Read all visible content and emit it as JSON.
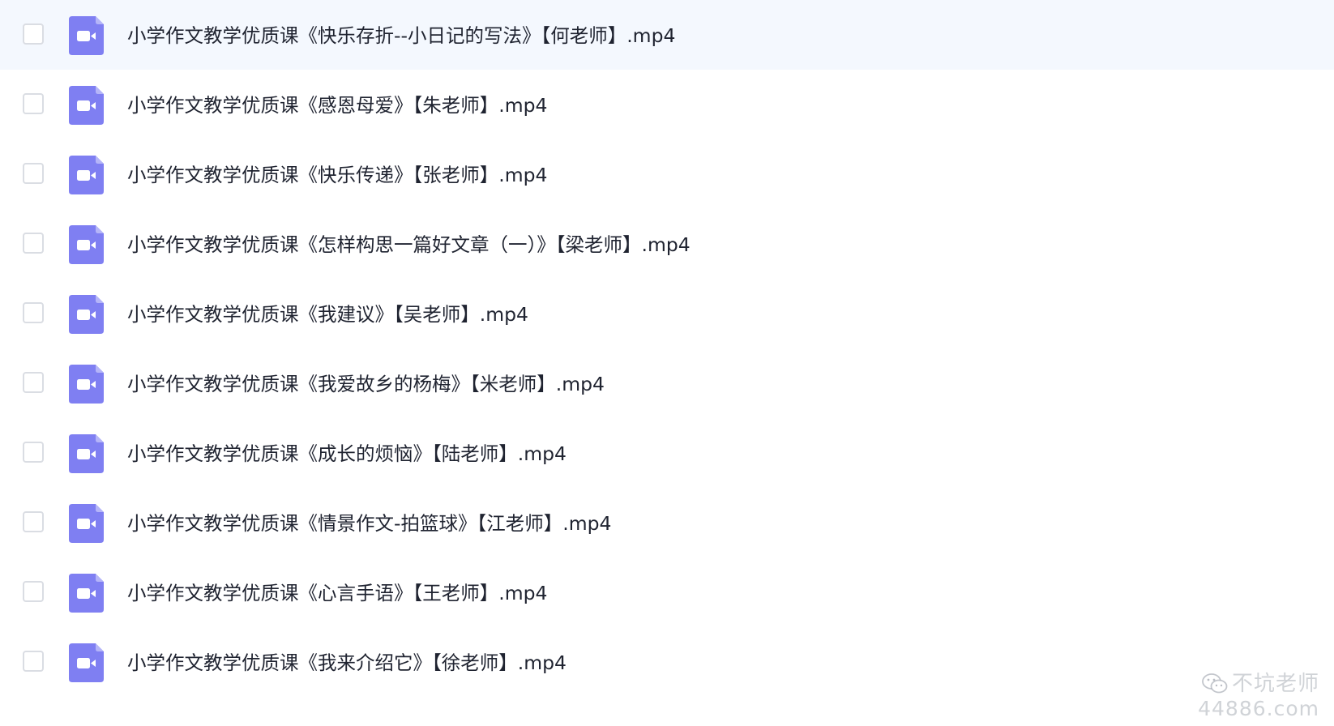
{
  "files": [
    {
      "name": "小学作文教学优质课《快乐存折--小日记的写法》【何老师】.mp4",
      "selected": true
    },
    {
      "name": "小学作文教学优质课《感恩母爱》【朱老师】.mp4",
      "selected": false
    },
    {
      "name": "小学作文教学优质课《快乐传递》【张老师】.mp4",
      "selected": false
    },
    {
      "name": "小学作文教学优质课《怎样构思一篇好文章（一）》【梁老师】.mp4",
      "selected": false
    },
    {
      "name": "小学作文教学优质课《我建议》【吴老师】.mp4",
      "selected": false
    },
    {
      "name": "小学作文教学优质课《我爱故乡的杨梅》【米老师】.mp4",
      "selected": false
    },
    {
      "name": "小学作文教学优质课《成长的烦恼》【陆老师】.mp4",
      "selected": false
    },
    {
      "name": "小学作文教学优质课《情景作文-拍篮球》【江老师】.mp4",
      "selected": false
    },
    {
      "name": "小学作文教学优质课《心言手语》【王老师】.mp4",
      "selected": false
    },
    {
      "name": "小学作文教学优质课《我来介绍它》【徐老师】.mp4",
      "selected": false
    }
  ],
  "file_icon": "video-file-icon",
  "watermark": {
    "icon": "wechat-icon",
    "line1": "不坑老师",
    "line2": "44886.com"
  },
  "colors": {
    "icon_purple": "#7f7ff2",
    "selected_row": "#f4f8fe",
    "text": "#1f2330",
    "divider": "#eceef2"
  }
}
